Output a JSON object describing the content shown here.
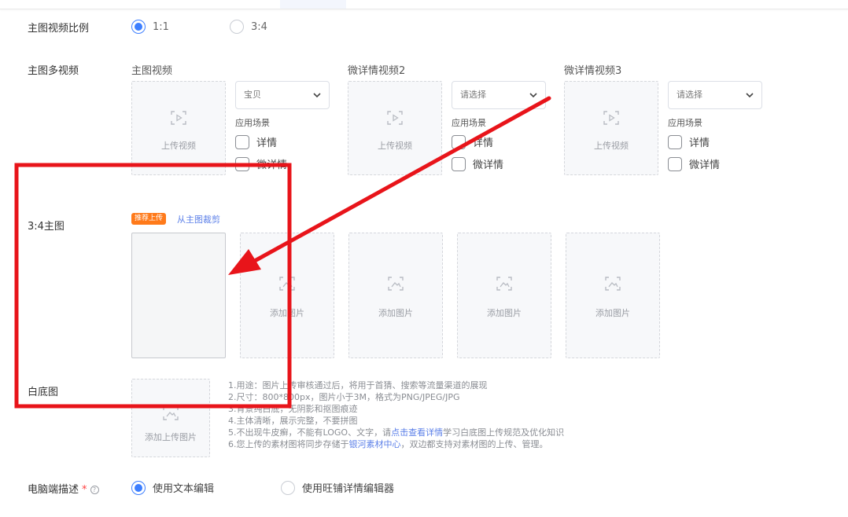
{
  "ratio": {
    "label": "主图视频比例",
    "options": [
      {
        "label": "1:1",
        "checked": true
      },
      {
        "label": "3:4",
        "checked": false
      }
    ]
  },
  "multi_video": {
    "label": "主图多视频",
    "upload_label": "上传视频",
    "scene_label": "应用场景",
    "columns": [
      {
        "title": "主图视频",
        "select": "宝贝",
        "checks": [
          "详情",
          "微详情"
        ]
      },
      {
        "title": "微详情视频2",
        "select": "请选择",
        "checks": [
          "详情",
          "微详情"
        ]
      },
      {
        "title": "微详情视频3",
        "select": "请选择",
        "checks": [
          "详情",
          "微详情"
        ]
      }
    ]
  },
  "main_34": {
    "label": "3:4主图",
    "badge": "推荐上传",
    "crop_link": "从主图裁剪",
    "add_label": "添加图片"
  },
  "white_bg": {
    "label": "白底图",
    "upload_label": "添加上传图片",
    "notes": {
      "l1": "1.用途：图片上传审核通过后，将用于首猜、搜索等流量渠道的展现",
      "l2": "2.尺寸：800*800px，图片小于3M，格式为PNG/JPEG/JPG",
      "l3": "3.背景纯白底，无阴影和抠图痕迹",
      "l4": "4.主体清晰，展示完整，不要拼图",
      "l5_pre": "5.不出现牛皮癣，不能有LOGO、文字，请",
      "l5_link": "点击查看详情",
      "l5_post": "学习白底图上传规范及优化知识",
      "l6_pre": "6.您上传的素材图将同步存储于",
      "l6_link": "银河素材中心",
      "l6_post": "，双边都支持对素材图的上传、管理。"
    }
  },
  "pc_desc": {
    "label": "电脑端描述",
    "required_mark": "*",
    "help": "?",
    "options": [
      {
        "label": "使用文本编辑",
        "checked": true
      },
      {
        "label": "使用旺铺详情编辑器",
        "checked": false
      }
    ]
  },
  "colors": {
    "accent": "#3d7fff",
    "badge": "#ff7a1a",
    "link": "#5b7fe8",
    "annotation": "#e8141a"
  }
}
